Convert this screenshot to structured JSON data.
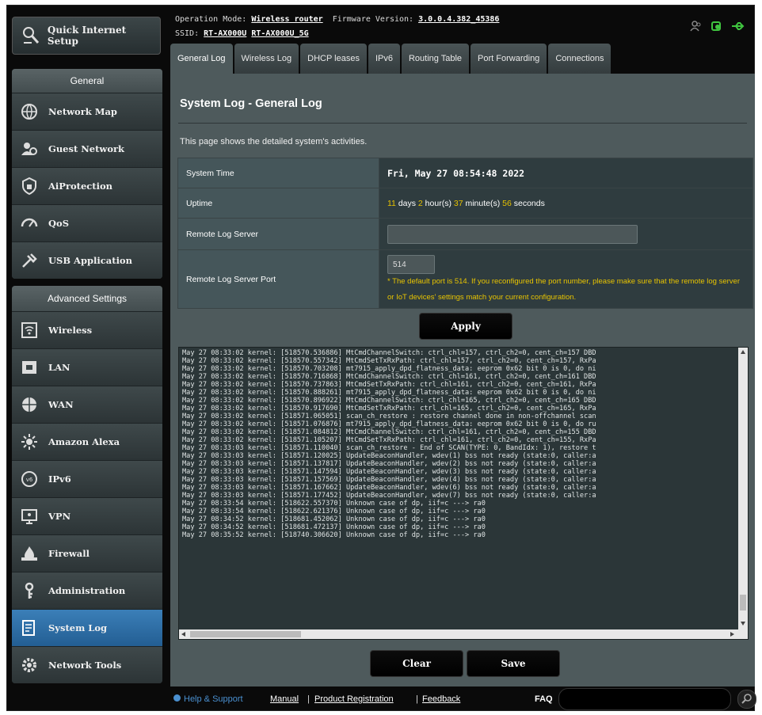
{
  "sidebar": {
    "quick_setup": "Quick Internet Setup",
    "general_header": "General",
    "general_items": [
      {
        "label": "Network Map",
        "icon": "network-map-icon"
      },
      {
        "label": "Guest Network",
        "icon": "guest-network-icon"
      },
      {
        "label": "AiProtection",
        "icon": "aiprotection-icon"
      },
      {
        "label": "QoS",
        "icon": "qos-icon"
      },
      {
        "label": "USB Application",
        "icon": "usb-application-icon"
      }
    ],
    "advanced_header": "Advanced Settings",
    "advanced_items": [
      {
        "label": "Wireless",
        "icon": "wireless-icon"
      },
      {
        "label": "LAN",
        "icon": "lan-icon"
      },
      {
        "label": "WAN",
        "icon": "wan-icon"
      },
      {
        "label": "Amazon Alexa",
        "icon": "amazon-alexa-icon"
      },
      {
        "label": "IPv6",
        "icon": "ipv6-icon"
      },
      {
        "label": "VPN",
        "icon": "vpn-icon"
      },
      {
        "label": "Firewall",
        "icon": "firewall-icon"
      },
      {
        "label": "Administration",
        "icon": "administration-icon"
      },
      {
        "label": "System Log",
        "icon": "system-log-icon",
        "active": true
      },
      {
        "label": "Network Tools",
        "icon": "network-tools-icon"
      }
    ]
  },
  "top": {
    "operation_mode_label": "Operation Mode:",
    "operation_mode": "Wireless router",
    "firmware_label": "Firmware Version:",
    "firmware": "3.0.0.4.382_45386",
    "ssid_label": "SSID:",
    "ssid_1": "RT-AX000U",
    "ssid_2": "RT-AX000U_5G"
  },
  "tabs": [
    "General Log",
    "Wireless Log",
    "DHCP leases",
    "IPv6",
    "Routing Table",
    "Port Forwarding",
    "Connections"
  ],
  "page": {
    "title": "System Log - General Log",
    "description": "This page shows the detailed system's activities.",
    "system_time_label": "System Time",
    "system_time": "Fri, May 27 08:54:48 2022",
    "uptime_label": "Uptime",
    "uptime": {
      "days": "11",
      "days_unit": " days ",
      "hours": "2",
      "hours_unit": " hour(s) ",
      "minutes": "37",
      "minutes_unit": " minute(s) ",
      "seconds": "56",
      "seconds_unit": " seconds"
    },
    "remote_log_server_label": "Remote Log Server",
    "remote_log_server": "",
    "remote_log_port_label": "Remote Log Server Port",
    "remote_log_port": "514",
    "port_note": "* The default port is 514. If you reconfigured the port number, please make sure that the remote log server or IoT devices' settings match your current configuration.",
    "apply": "Apply",
    "clear": "Clear",
    "save": "Save"
  },
  "log": [
    "May 27 08:33:02 kernel: [518570.536886] MtCmdChannelSwitch: ctrl_chl=157, ctrl_ch2=0, cent_ch=157 DBD",
    "May 27 08:33:02 kernel: [518570.557342] MtCmdSetTxRxPath: ctrl_chl=157, ctrl_ch2=0, cent_ch=157, RxPa",
    "May 27 08:33:02 kernel: [518570.703208] mt7915_apply_dpd_flatness_data: eeprom 0x62 bit 0 is 0, do ni",
    "May 27 08:33:02 kernel: [518570.716868] MtCmdChannelSwitch: ctrl_chl=161, ctrl_ch2=0, cent_ch=161 DBD",
    "May 27 08:33:02 kernel: [518570.737863] MtCmdSetTxRxPath: ctrl_chl=161, ctrl_ch2=0, cent_ch=161, RxPa",
    "May 27 08:33:02 kernel: [518570.888261] mt7915_apply_dpd_flatness_data: eeprom 0x62 bit 0 is 0, do ni",
    "May 27 08:33:02 kernel: [518570.896922] MtCmdChannelSwitch: ctrl_chl=165, ctrl_ch2=0, cent_ch=165 DBD",
    "May 27 08:33:02 kernel: [518570.917690] MtCmdSetTxRxPath: ctrl_chl=165, ctrl_ch2=0, cent_ch=165, RxPa",
    "May 27 08:33:02 kernel: [518571.065051] scan_ch_restore : restore channel done in non-offchannel scan",
    "May 27 08:33:02 kernel: [518571.076876] mt7915_apply_dpd_flatness_data: eeprom 0x62 bit 0 is 0, do ru",
    "May 27 08:33:02 kernel: [518571.084812] MtCmdChannelSwitch: ctrl_chl=161, ctrl_ch2=0, cent_ch=155 DBD",
    "May 27 08:33:02 kernel: [518571.105207] MtCmdSetTxRxPath: ctrl_chl=161, ctrl_ch2=0, cent_ch=155, RxPa",
    "May 27 08:33:03 kernel: [518571.110040] scan_ch_restore - End of SCAN(TYPE: 0, BandIdx: 1), restore t",
    "May 27 08:33:03 kernel: [518571.120025] UpdateBeaconHandler, wdev(1) bss not ready (state:0, caller:a",
    "May 27 08:33:03 kernel: [518571.137817] UpdateBeaconHandler, wdev(2) bss not ready (state:0, caller:a",
    "May 27 08:33:03 kernel: [518571.147594] UpdateBeaconHandler, wdev(3) bss not ready (state:0, caller:a",
    "May 27 08:33:03 kernel: [518571.157569] UpdateBeaconHandler, wdev(4) bss not ready (state:0, caller:a",
    "May 27 08:33:03 kernel: [518571.167662] UpdateBeaconHandler, wdev(6) bss not ready (state:0, caller:a",
    "May 27 08:33:03 kernel: [518571.177452] UpdateBeaconHandler, wdev(7) bss not ready (state:0, caller:a",
    "May 27 08:33:54 kernel: [518622.557370] Unknown case of dp, iif=c ---> ra0",
    "May 27 08:33:54 kernel: [518622.621376] Unknown case of dp, iif=c ---> ra0",
    "May 27 08:34:52 kernel: [518681.452062] Unknown case of dp, iif=c ---> ra0",
    "May 27 08:34:52 kernel: [518681.472137] Unknown case of dp, iif=c ---> ra0",
    "May 27 08:35:52 kernel: [518740.306620] Unknown case of dp, iif=c ---> ra0"
  ],
  "footer": {
    "help": "Help & Support",
    "manual": "Manual",
    "sep1": "|",
    "product_registration": "Product Registration",
    "sep2": "|",
    "feedback": "Feedback",
    "faq": "FAQ"
  },
  "colors": {
    "accent": "#2f6aa3",
    "highlight": "#e6c200",
    "panel": "#4e5a5c"
  }
}
